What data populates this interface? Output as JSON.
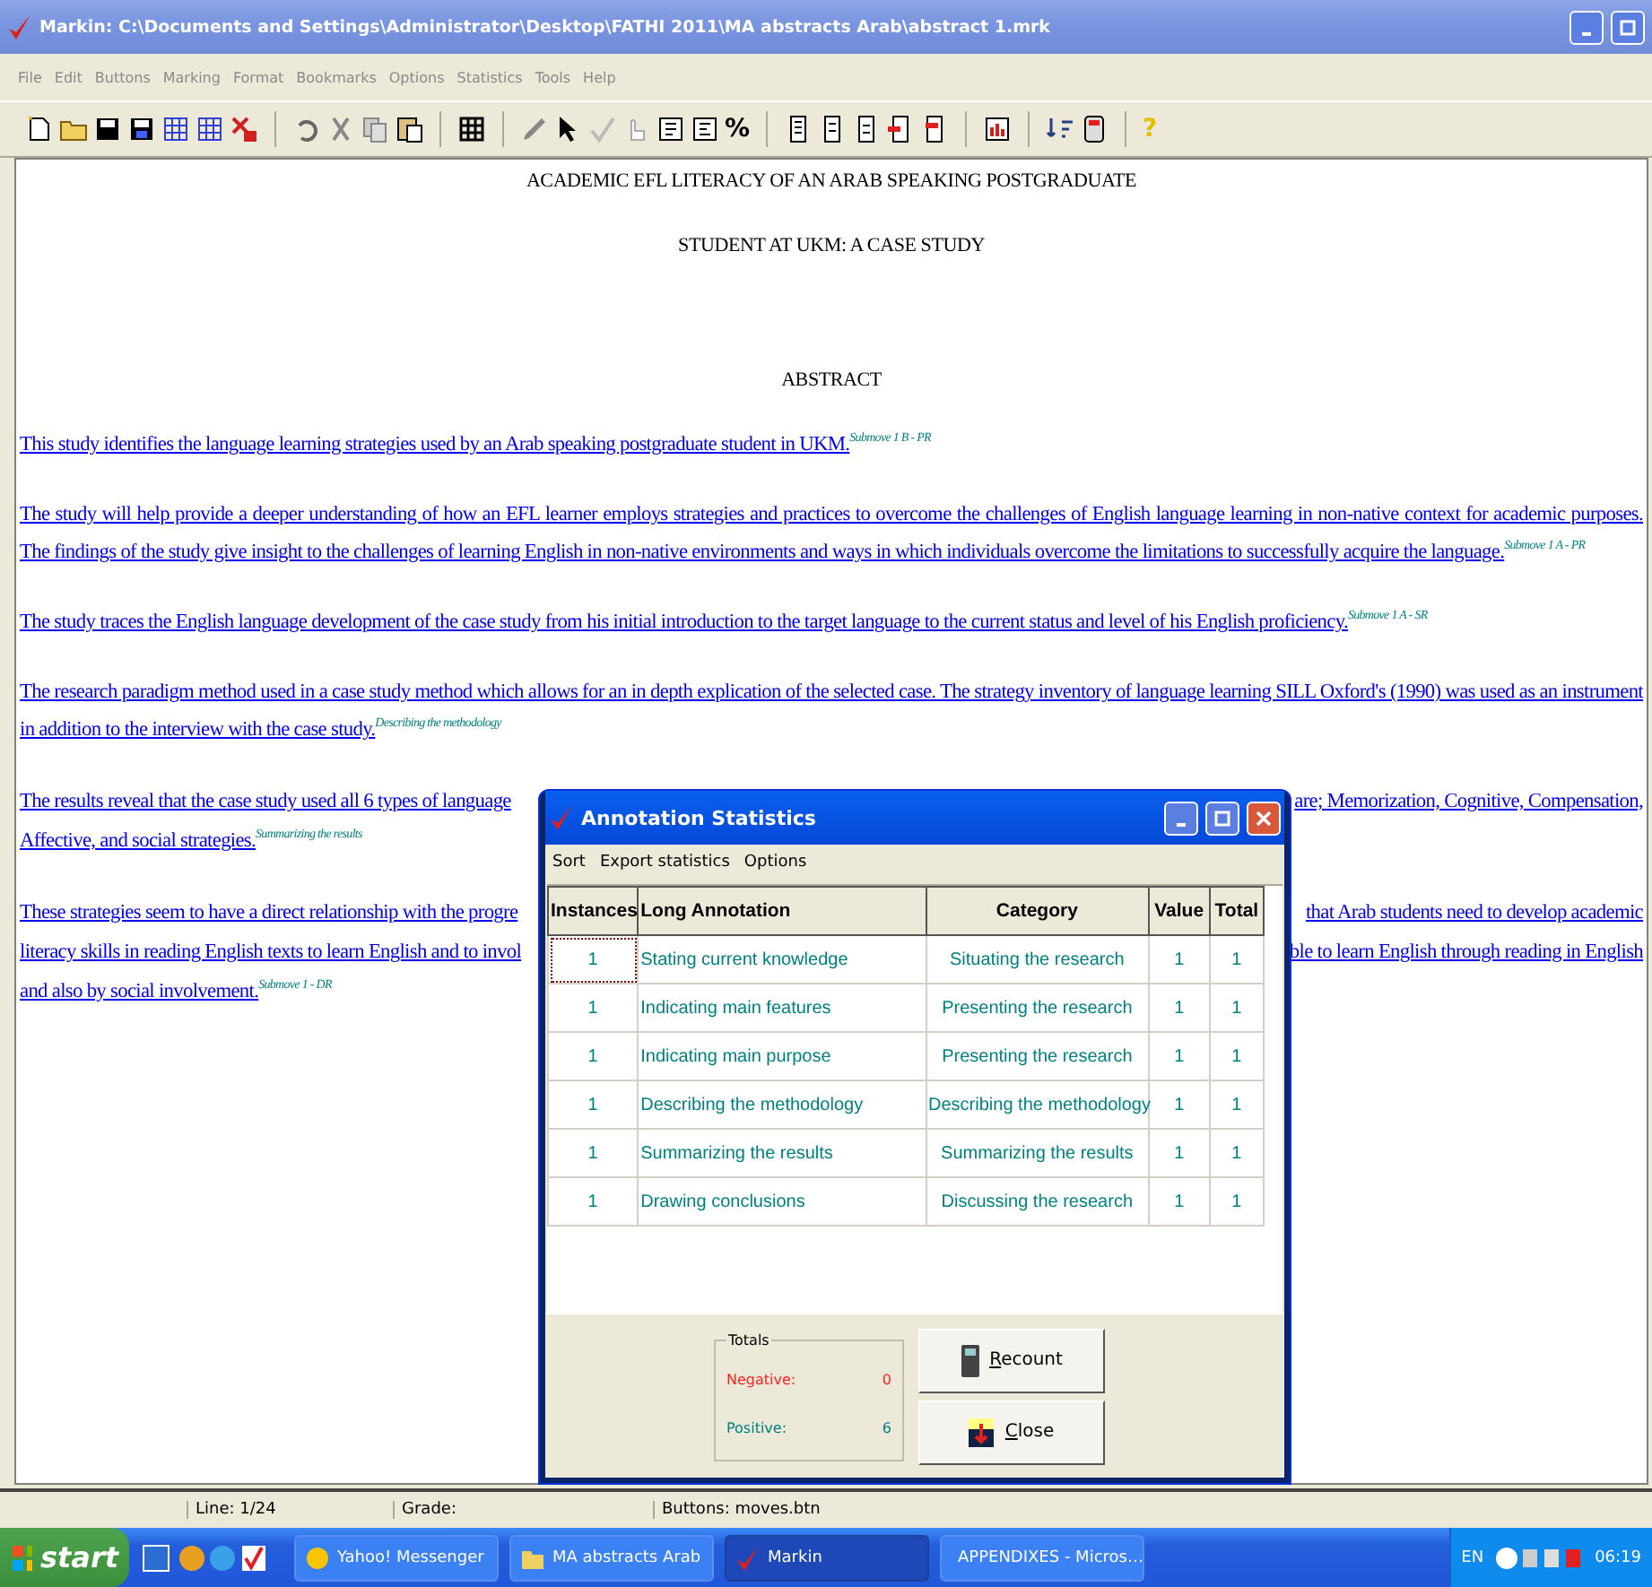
{
  "window": {
    "title": "Markin: C:\\Documents and Settings\\Administrator\\Desktop\\FATHI 2011\\MA abstracts Arab\\abstract 1.mrk"
  },
  "menu": [
    "File",
    "Edit",
    "Buttons",
    "Marking",
    "Format",
    "Bookmarks",
    "Options",
    "Statistics",
    "Tools",
    "Help"
  ],
  "toolbar": {
    "percent_label": "%",
    "help_label": "?"
  },
  "document": {
    "title_lines": [
      "ACADEMIC EFL LITERACY OF AN ARAB SPEAKING POSTGRADUATE",
      "STUDENT AT UKM: A CASE STUDY"
    ],
    "heading": "ABSTRACT",
    "paragraphs": [
      {
        "kind": "full",
        "text": "This study identifies the language learning strategies used by an Arab speaking postgraduate student in UKM.",
        "annotation": "Submove 1 B - PR"
      },
      {
        "kind": "full",
        "text": " The study will help provide a deeper understanding of how an EFL learner employs strategies and practices to overcome the challenges of English language learning in non-native context for academic purposes. The findings of the study give insight to the challenges of learning English in non-native environments and ways in which individuals overcome the limitations to successfully acquire the language.",
        "annotation": "Submove 1 A - PR"
      },
      {
        "kind": "full",
        "text": "The study traces the English language development of the case study from his initial introduction to the target language to the current status and level of his English proficiency.",
        "annotation": "Submove 1 A - SR"
      },
      {
        "kind": "full",
        "text": "The research paradigm method used in a case study method which allows for an in depth explication of the selected case. The strategy inventory of language learning SILL Oxford's (1990) was used as an instrument in addition to the interview with the case study.",
        "annotation": "Describing the methodology"
      },
      {
        "kind": "covered",
        "lines": [
          {
            "left": "The results reveal that the case study used all 6 types of language",
            "right": "are; Memorization, Cognitive, Compensation,"
          },
          {
            "left": "Affective, and social strategies."
          }
        ],
        "annotation": "Summarizing the results"
      },
      {
        "kind": "covered",
        "lines": [
          {
            "left": "These strategies seem to have a direct relationship with the progre",
            "right": "that Arab students need to develop academic"
          },
          {
            "left": "literacy skills in reading English texts to learn English and to invol",
            "right": "ble to learn English through reading in English"
          },
          {
            "left": "and also by social involvement."
          }
        ],
        "annotation": "Submove 1 - DR"
      }
    ]
  },
  "status_bar": [
    "Line: 1/24",
    "Grade:",
    "Buttons: moves.btn"
  ],
  "dialog": {
    "title": "Annotation Statistics",
    "menu": [
      "Sort",
      "Export statistics",
      "Options"
    ],
    "columns": [
      "Instances",
      "Long Annotation",
      "Category",
      "Value",
      "Total"
    ],
    "rows": [
      {
        "selected": true,
        "cells": [
          "1",
          "Stating current knowledge",
          "Situating the research",
          "1",
          "1"
        ]
      },
      {
        "selected": false,
        "cells": [
          "1",
          "Indicating main features",
          "Presenting the research",
          "1",
          "1"
        ]
      },
      {
        "selected": false,
        "cells": [
          "1",
          "Indicating main purpose",
          "Presenting the research",
          "1",
          "1"
        ]
      },
      {
        "selected": false,
        "cells": [
          "1",
          "Describing the methodology",
          "Describing the methodology",
          "1",
          "1"
        ]
      },
      {
        "selected": false,
        "cells": [
          "1",
          "Summarizing the results",
          "Summarizing the results",
          "1",
          "1"
        ]
      },
      {
        "selected": false,
        "cells": [
          "1",
          "Drawing conclusions",
          "Discussing the research",
          "1",
          "1"
        ]
      }
    ],
    "totals": {
      "legend": "Totals",
      "items": [
        {
          "label": "Negative:",
          "value": "0",
          "color": "#ff2020"
        },
        {
          "label": "Positive:",
          "value": "6",
          "color": "#008080"
        }
      ]
    },
    "buttons": [
      {
        "kind": "recount",
        "label": "Recount"
      },
      {
        "kind": "close",
        "label": "Close"
      }
    ]
  },
  "taskbar": {
    "start": "start",
    "tasks": [
      {
        "kind": "messenger",
        "label": "Yahoo! Messenger",
        "selected": false
      },
      {
        "kind": "folder",
        "label": "MA abstracts Arab",
        "selected": false
      },
      {
        "kind": "markin",
        "label": "Markin",
        "selected": true
      },
      {
        "kind": "document",
        "label": "APPENDIXES - Micros…",
        "selected": false
      }
    ],
    "language": "EN",
    "time": "06:19"
  }
}
